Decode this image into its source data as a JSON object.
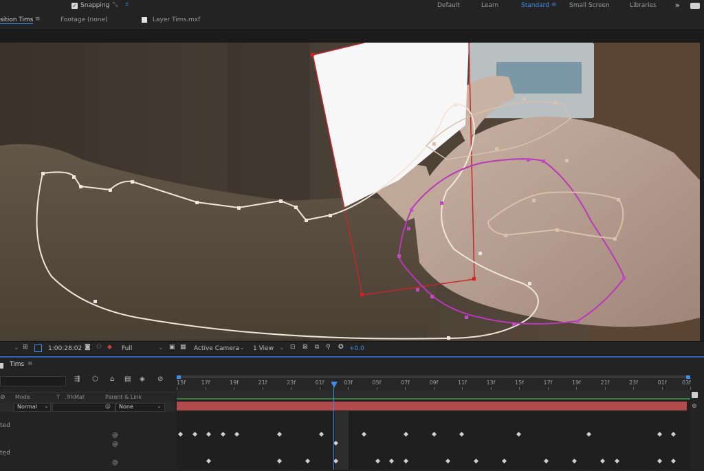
{
  "toolbar": {
    "snapping_label": "Snapping",
    "workspaces": [
      {
        "label": "Default",
        "active": false
      },
      {
        "label": "Learn",
        "active": false
      },
      {
        "label": "Standard",
        "active": true
      },
      {
        "label": "Small Screen",
        "active": false
      },
      {
        "label": "Libraries",
        "active": false
      }
    ],
    "more": "»"
  },
  "panel_tabs": {
    "composition": "sition Tims",
    "footage": "Footage (none)",
    "layer": "Layer Tims.mxf"
  },
  "viewer_bar": {
    "timecode": "1:00:28:02",
    "resolution": "Full",
    "camera": "Active Camera",
    "view": "1 View",
    "exposure": "+0.0"
  },
  "timeline": {
    "comp_tab": "Tims",
    "columns": {
      "mode": "Mode",
      "t": "T",
      "trkmat": ".TrkMat",
      "parent": "Parent & Link"
    },
    "layer": {
      "mode": "Normal",
      "parent": "None"
    },
    "rows": [
      "ted",
      "ted"
    ],
    "ruler_labels": [
      "15f",
      "17f",
      "19f",
      "21f",
      "23f",
      "01f",
      "03f",
      "05f",
      "07f",
      "09f",
      "11f",
      "13f",
      "15f",
      "17f",
      "19f",
      "21f",
      "23f",
      "01f",
      "03f"
    ],
    "accent": "#3d8fe6",
    "layer_bar_color": "#b24b4b"
  }
}
